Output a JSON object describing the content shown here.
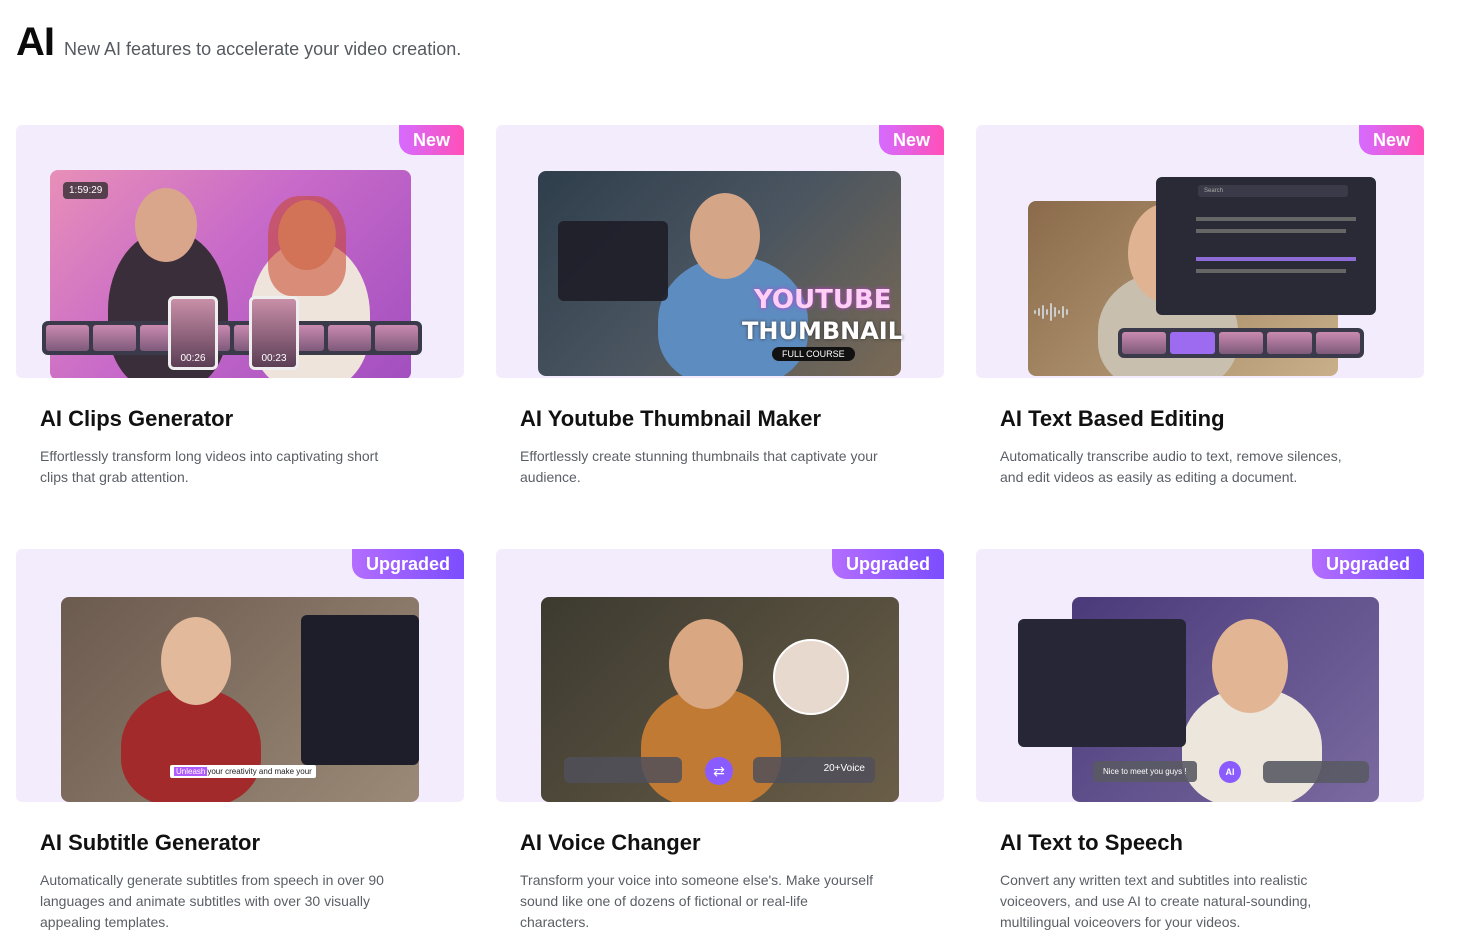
{
  "header": {
    "title": "AI",
    "subtitle": "New AI features to accelerate your video creation."
  },
  "cards": [
    {
      "badge": "New",
      "title": "AI Clips Generator",
      "description": "Effortlessly transform long videos into captivating short clips that grab attention.",
      "overlay": {
        "timecode": "1:59:29",
        "clip1": "00:26",
        "clip2": "00:23"
      }
    },
    {
      "badge": "New",
      "title": "AI Youtube Thumbnail Maker",
      "description": "Effortlessly create stunning thumbnails that captivate your audience.",
      "overlay": {
        "line1": "YOUTUBE",
        "line2": "THUMBNAIL",
        "tag": "FULL COURSE"
      }
    },
    {
      "badge": "New",
      "title": "AI Text Based Editing",
      "description": "Automatically transcribe audio to text, remove silences, and edit videos as easily as editing a document.",
      "overlay": {
        "search": "Search"
      }
    },
    {
      "badge": "Upgraded",
      "title": "AI Subtitle Generator",
      "description": "Automatically generate subtitles from speech in over 90 languages and animate subtitles with over 30 visually appealing templates.",
      "overlay": {
        "highlight": "Unleash",
        "caption": "your creativity and make your"
      }
    },
    {
      "badge": "Upgraded",
      "title": "AI Voice Changer",
      "description": "Transform your voice into someone else's. Make yourself sound like one of dozens of fictional or real-life characters.",
      "overlay": {
        "voices": "20+Voice"
      }
    },
    {
      "badge": "Upgraded",
      "title": "AI Text to Speech",
      "description": "Convert any written text and subtitles into realistic voiceovers, and use AI to create natural-sounding, multilingual voiceovers for your videos.",
      "overlay": {
        "bubble": "Nice to meet you guys !",
        "ai": "AI"
      }
    }
  ],
  "colors": {
    "card_bg": "#f3ecfc",
    "badge_new": "#ff4fb8",
    "badge_upgraded": "#7b4dff"
  }
}
